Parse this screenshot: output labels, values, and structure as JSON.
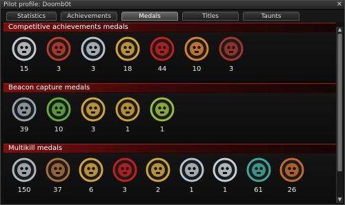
{
  "window": {
    "title": "Pilot profile: Doomb0t",
    "close_label": "✕"
  },
  "tabs": [
    {
      "label": "Statistics"
    },
    {
      "label": "Achievements"
    },
    {
      "label": "Medals",
      "active": true
    },
    {
      "label": "Titles"
    },
    {
      "label": "Taunts"
    }
  ],
  "sections": [
    {
      "title": "Competitive achievements medals",
      "medals": [
        {
          "count": "15",
          "icon": "skull-crosshair-medal-icon"
        },
        {
          "count": "3",
          "icon": "red-skull-crosshair-medal-icon"
        },
        {
          "count": "3",
          "icon": "winged-crosshair-medal-icon"
        },
        {
          "count": "18",
          "icon": "gold-emblem-medal-icon"
        },
        {
          "count": "44",
          "icon": "red-star-medal-icon"
        },
        {
          "count": "10",
          "icon": "red-gold-star-medal-icon"
        },
        {
          "count": "3",
          "icon": "red-gold-crest-medal-icon"
        }
      ]
    },
    {
      "title": "Beacon capture medals",
      "medals": [
        {
          "count": "39",
          "icon": "silver-beacon-medal-icon"
        },
        {
          "count": "10",
          "icon": "green-hex-beacon-medal-icon"
        },
        {
          "count": "3",
          "icon": "gold-cross-beacon-medal-icon"
        },
        {
          "count": "1",
          "icon": "gold-star-beacon-medal-icon"
        },
        {
          "count": "1",
          "icon": "gold-winged-beacon-medal-icon"
        }
      ]
    },
    {
      "title": "Multikill medals",
      "medals": [
        {
          "count": "150",
          "icon": "skull-star-medal-icon"
        },
        {
          "count": "37",
          "icon": "bronze-skull-medal-icon"
        },
        {
          "count": "6",
          "icon": "gold-skull-medal-icon"
        },
        {
          "count": "3",
          "icon": "red-bar-skull-medal-icon"
        },
        {
          "count": "2",
          "icon": "gold-cross-skull-medal-icon"
        },
        {
          "count": "1",
          "icon": "silver-skull-medal-icon"
        },
        {
          "count": "1",
          "icon": "crowned-skull-medal-icon"
        },
        {
          "count": "61",
          "icon": "teal-skull-medal-icon"
        },
        {
          "count": "26",
          "icon": "ornate-skull-medal-icon"
        }
      ]
    }
  ],
  "colors": {
    "section_header": "#7a1010",
    "accent_red": "#c81e1e",
    "gold": "#d4a63a",
    "silver": "#b8c2cc"
  }
}
